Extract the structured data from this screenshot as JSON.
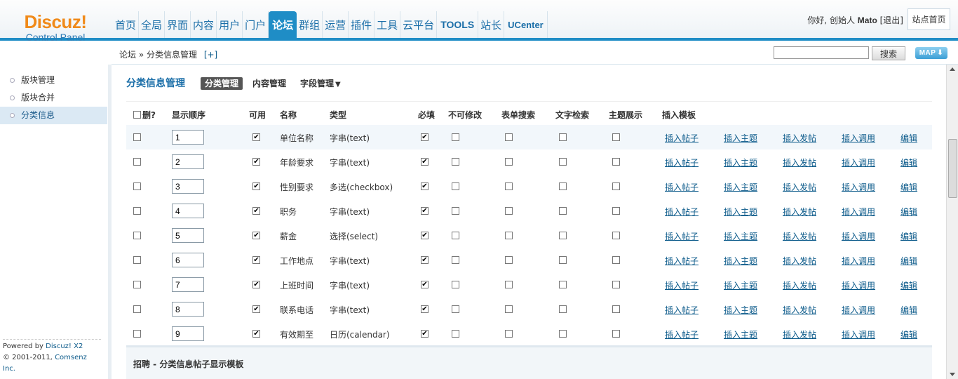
{
  "logo": {
    "brand": "Discuz!",
    "sub": "Control Panel"
  },
  "nav": {
    "items": [
      {
        "label": "首页",
        "name": "nav-home"
      },
      {
        "label": "全局",
        "name": "nav-global"
      },
      {
        "label": "界面",
        "name": "nav-ui"
      },
      {
        "label": "内容",
        "name": "nav-content"
      },
      {
        "label": "用户",
        "name": "nav-users"
      },
      {
        "label": "门户",
        "name": "nav-portal"
      },
      {
        "label": "论坛",
        "name": "nav-forum"
      },
      {
        "label": "群组",
        "name": "nav-groups"
      },
      {
        "label": "运营",
        "name": "nav-operations"
      },
      {
        "label": "插件",
        "name": "nav-plugins"
      },
      {
        "label": "工具",
        "name": "nav-tools"
      },
      {
        "label": "云平台",
        "name": "nav-cloud"
      },
      {
        "label": "TOOLS",
        "name": "nav-tools-latin"
      },
      {
        "label": "站长",
        "name": "nav-webmaster"
      },
      {
        "label": "UCenter",
        "name": "nav-ucenter"
      }
    ],
    "active": "论坛"
  },
  "userbar": {
    "greeting": "你好, 创始人",
    "username": "Mato",
    "logout": "[退出]",
    "site_home": "站点首页"
  },
  "breadcrumb": {
    "path": "论坛 » 分类信息管理",
    "add": "[+]"
  },
  "search": {
    "value": "",
    "button": "搜索",
    "map": "MAP"
  },
  "sidebar": {
    "items": [
      "版块管理",
      "版块合并",
      "分类信息"
    ],
    "active_index": 2
  },
  "footer": {
    "powered": "Powered by",
    "product": "Discuz! X2",
    "copyright": "© 2001-2011,",
    "company": "Comsenz Inc."
  },
  "main": {
    "title": "分类信息管理",
    "tabs": [
      {
        "label": "分类管理",
        "active": true
      },
      {
        "label": "内容管理",
        "active": false
      },
      {
        "label": "字段管理",
        "active": false,
        "caret": "▼"
      }
    ],
    "headers": {
      "delete": "删?",
      "order": "显示顺序",
      "enabled": "可用",
      "name": "名称",
      "type": "类型",
      "required": "必填",
      "unchangeable": "不可修改",
      "form_search": "表单搜索",
      "text_search": "文字检索",
      "subject_show": "主题展示",
      "insert_template": "插入模板"
    },
    "link_labels": [
      "插入帖子",
      "插入主题",
      "插入发帖",
      "插入调用",
      "编辑"
    ],
    "rows": [
      {
        "order": "1",
        "enabled": true,
        "name": "单位名称",
        "type": "字串(text)",
        "required": true,
        "unchangeable": false,
        "form_search": false,
        "text_search": false,
        "subject_show": false
      },
      {
        "order": "2",
        "enabled": true,
        "name": "年龄要求",
        "type": "字串(text)",
        "required": true,
        "unchangeable": false,
        "form_search": false,
        "text_search": false,
        "subject_show": false
      },
      {
        "order": "3",
        "enabled": true,
        "name": "性别要求",
        "type": "多选(checkbox)",
        "required": true,
        "unchangeable": false,
        "form_search": false,
        "text_search": false,
        "subject_show": false
      },
      {
        "order": "4",
        "enabled": true,
        "name": "职务",
        "type": "字串(text)",
        "required": true,
        "unchangeable": false,
        "form_search": false,
        "text_search": false,
        "subject_show": false
      },
      {
        "order": "5",
        "enabled": true,
        "name": "薪金",
        "type": "选择(select)",
        "required": true,
        "unchangeable": false,
        "form_search": false,
        "text_search": false,
        "subject_show": false
      },
      {
        "order": "6",
        "enabled": true,
        "name": "工作地点",
        "type": "字串(text)",
        "required": true,
        "unchangeable": false,
        "form_search": false,
        "text_search": false,
        "subject_show": false
      },
      {
        "order": "7",
        "enabled": true,
        "name": "上班时间",
        "type": "字串(text)",
        "required": true,
        "unchangeable": false,
        "form_search": false,
        "text_search": false,
        "subject_show": false
      },
      {
        "order": "8",
        "enabled": true,
        "name": "联系电话",
        "type": "字串(text)",
        "required": true,
        "unchangeable": false,
        "form_search": false,
        "text_search": false,
        "subject_show": false
      },
      {
        "order": "9",
        "enabled": true,
        "name": "有效期至",
        "type": "日历(calendar)",
        "required": true,
        "unchangeable": false,
        "form_search": false,
        "text_search": false,
        "subject_show": false
      }
    ],
    "bottom_title": "招聘 - 分类信息帖子显示模板"
  }
}
